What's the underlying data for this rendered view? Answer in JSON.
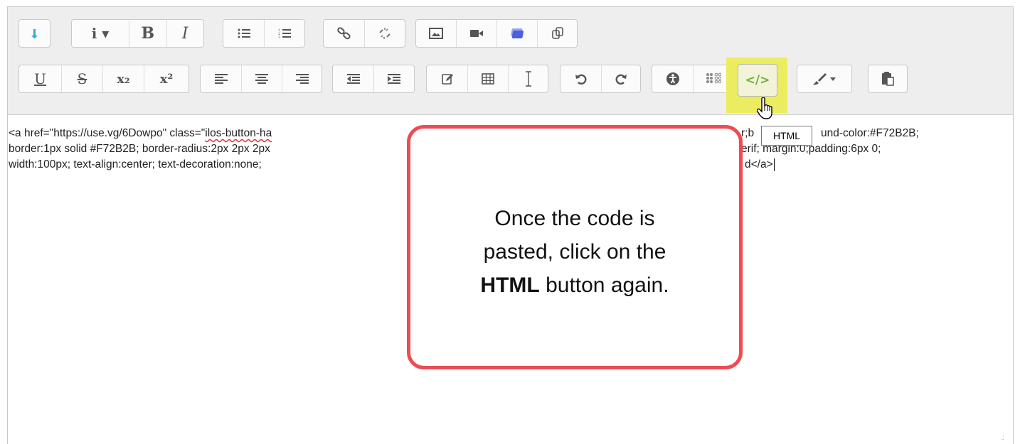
{
  "toolbar": {
    "row1": [
      {
        "name": "show-more-buttons-icon"
      },
      {
        "name": "paragraph-style-icon",
        "label": "i ▾"
      },
      {
        "name": "bold-icon",
        "label": "B"
      },
      {
        "name": "italic-icon",
        "label": "I"
      },
      {
        "name": "unordered-list-icon"
      },
      {
        "name": "ordered-list-icon"
      },
      {
        "name": "link-icon"
      },
      {
        "name": "unlink-icon"
      },
      {
        "name": "image-icon"
      },
      {
        "name": "video-icon"
      },
      {
        "name": "manage-files-icon"
      },
      {
        "name": "copy-icon"
      }
    ],
    "row2": [
      {
        "name": "underline-icon",
        "label": "U"
      },
      {
        "name": "strikethrough-icon",
        "label": "S"
      },
      {
        "name": "subscript-icon",
        "label": "x₂"
      },
      {
        "name": "superscript-icon",
        "label": "x²"
      },
      {
        "name": "align-left-icon"
      },
      {
        "name": "align-center-icon"
      },
      {
        "name": "align-right-icon"
      },
      {
        "name": "outdent-icon"
      },
      {
        "name": "indent-icon"
      },
      {
        "name": "equation-icon"
      },
      {
        "name": "table-icon"
      },
      {
        "name": "clear-formatting-icon"
      },
      {
        "name": "undo-icon"
      },
      {
        "name": "redo-icon"
      },
      {
        "name": "accessibility-icon"
      },
      {
        "name": "screenreader-icon"
      },
      {
        "name": "html-code-icon",
        "label": "</>"
      },
      {
        "name": "brush-icon"
      },
      {
        "name": "paste-icon"
      }
    ],
    "html_tooltip": "HTML"
  },
  "content": {
    "line1_a": "<a href=\"https://use.vg/6Dowpo\"   class=\"",
    "line1_b": "ilos-button-ha",
    "line1_c": "r;b",
    "line1_d": "und-color:#F72B2B;",
    "line2_a": "border:1px solid #F72B2B;   border-radius:2px 2px 2px",
    "line2_b": "erif;   margin:0;padding:6px 0;",
    "line3_a": "width:100px;   text-align:center;   text-decoration:none;",
    "line3_b": "d</a>"
  },
  "callout": {
    "line1": "Once the code is",
    "line2": "pasted, click on the",
    "bold": "HTML",
    "line3_rest": " button again."
  },
  "colors": {
    "highlight": "#ecec61",
    "callout_border": "#ee4b53",
    "html_icon": "#6cb33f",
    "image_accent": "#4c5fe0",
    "squiggle": "#e53935"
  }
}
